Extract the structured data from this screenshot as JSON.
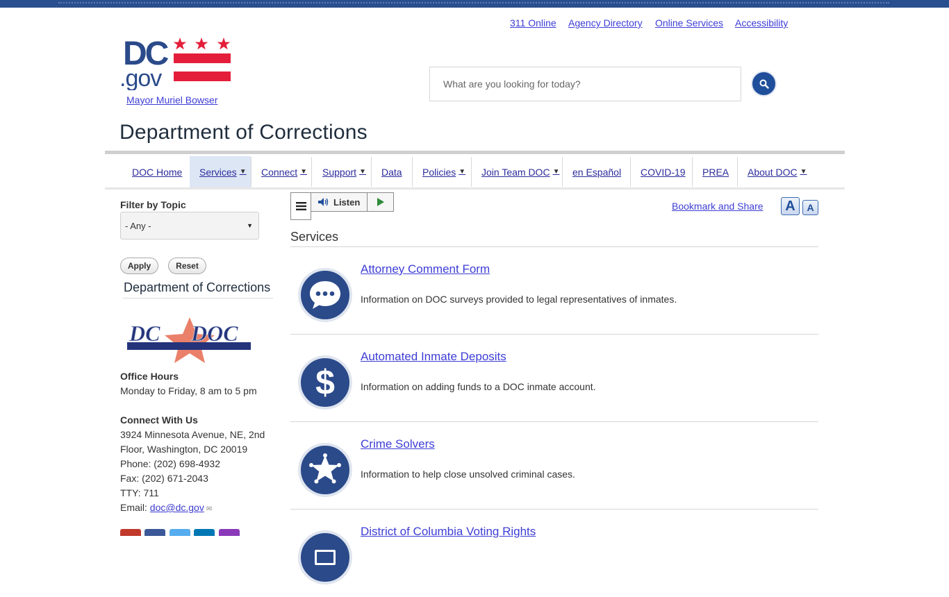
{
  "utility_nav": [
    "311 Online",
    "Agency Directory",
    "Online Services",
    "Accessibility"
  ],
  "header": {
    "logo_alt": "DC.gov",
    "mayor_link": "Mayor Muriel Bowser",
    "site_title": "Department of Corrections"
  },
  "search": {
    "placeholder": "What are you looking for today?",
    "button_icon": "search-icon"
  },
  "main_nav": [
    {
      "label": "DOC Home",
      "has_dropdown": false,
      "active": false
    },
    {
      "label": "Services",
      "has_dropdown": true,
      "active": true
    },
    {
      "label": "Connect",
      "has_dropdown": true,
      "active": false
    },
    {
      "label": "Support",
      "has_dropdown": true,
      "active": false
    },
    {
      "label": "Data",
      "has_dropdown": false,
      "active": false
    },
    {
      "label": "Policies",
      "has_dropdown": true,
      "active": false
    },
    {
      "label": "Join Team DOC",
      "has_dropdown": true,
      "active": false
    },
    {
      "label": "en Español",
      "has_dropdown": false,
      "active": false
    },
    {
      "label": "COVID-19",
      "has_dropdown": false,
      "active": false
    },
    {
      "label": "PREA",
      "has_dropdown": false,
      "active": false
    },
    {
      "label": "About DOC",
      "has_dropdown": true,
      "active": false
    }
  ],
  "sidebar": {
    "filter_label": "Filter by Topic",
    "filter_value": "- Any -",
    "apply_label": "Apply",
    "reset_label": "Reset",
    "heading": "Department of Corrections",
    "office_hours_title": "Office Hours",
    "office_hours": "Monday to Friday, 8 am to 5 pm",
    "connect_title": "Connect With Us",
    "address_line1": "3924 Minnesota Avenue, NE, 2nd",
    "address_line2": "Floor, Washington, DC 20019",
    "phone": "Phone: (202) 698-4932",
    "fax": "Fax: (202) 671-2043",
    "tty": "TTY: 711",
    "email_label": "Email: ",
    "email": "doc@dc.gov",
    "social_colors": [
      "#c0392b",
      "#3b5998",
      "#55acee",
      "#0077b5",
      "#8a3ab9"
    ]
  },
  "toolbar": {
    "listen_label": "Listen",
    "bookmark_label": "Bookmark and Share",
    "font_increase": "A",
    "font_decrease": "A"
  },
  "content": {
    "section_title": "Services",
    "services": [
      {
        "title": "Attorney Comment Form",
        "desc": "Information on DOC surveys provided to legal representatives of inmates.",
        "icon": "speech-bubble-icon"
      },
      {
        "title": "Automated Inmate Deposits",
        "desc": "Information on adding funds to a DOC inmate account.",
        "icon": "dollar-icon"
      },
      {
        "title": "Crime Solvers",
        "desc": "Information to help close unsolved criminal cases.",
        "icon": "sheriff-star-icon"
      },
      {
        "title": "District of Columbia Voting Rights",
        "desc": "",
        "icon": "ballot-icon"
      }
    ]
  },
  "colors": {
    "brand_blue": "#2b4a8a",
    "link": "#3d3dd6",
    "dc_red": "#e41e3a",
    "nav_active_bg": "#dde6f4"
  }
}
